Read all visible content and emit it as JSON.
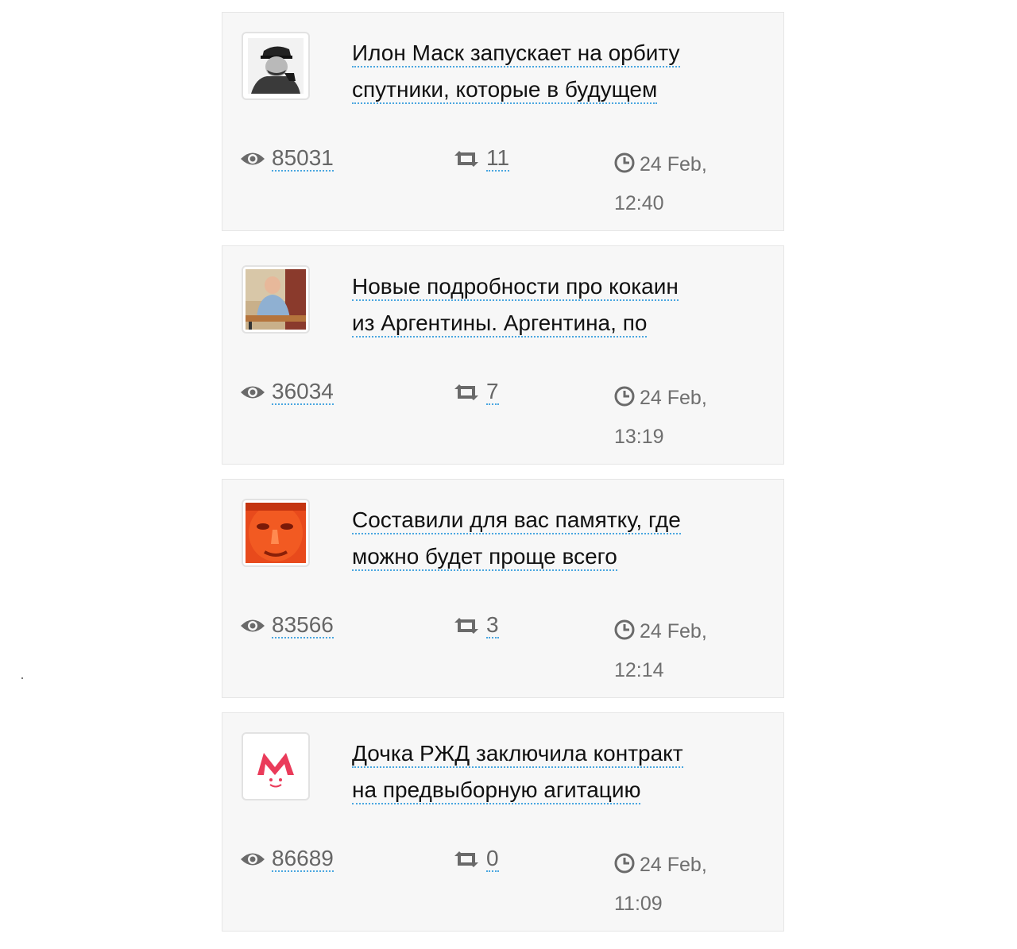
{
  "posts": [
    {
      "avatar": "stalin-photo",
      "title_line1": "Илон Маск запускает на орбиту",
      "title_line2": "спутники, которые в будущем",
      "views": "85031",
      "reposts": "11",
      "date": "24 Feb,",
      "time": "12:40"
    },
    {
      "avatar": "man-at-desk-photo",
      "title_line1": "Новые подробности про кокаин",
      "title_line2": "из Аргентины. Аргентина, по",
      "views": "36034",
      "reposts": "7",
      "date": "24 Feb,",
      "time": "13:19"
    },
    {
      "avatar": "red-face-photo",
      "title_line1": "Составили для вас памятку, где",
      "title_line2": "можно будет проще всего",
      "views": "83566",
      "reposts": "3",
      "date": "24 Feb,",
      "time": "12:14"
    },
    {
      "avatar": "red-m-logo",
      "title_line1": "Дочка РЖД заключила контракт",
      "title_line2": "на предвыборную агитацию",
      "views": "86689",
      "reposts": "0",
      "date": "24 Feb,",
      "time": "11:09"
    }
  ],
  "icons": {
    "views": "eye-icon",
    "reposts": "repost-icon",
    "date": "clock-icon"
  },
  "colors": {
    "link_underline": "#4aa6e0",
    "card_bg": "#f7f7f7",
    "muted_text": "#666666"
  }
}
